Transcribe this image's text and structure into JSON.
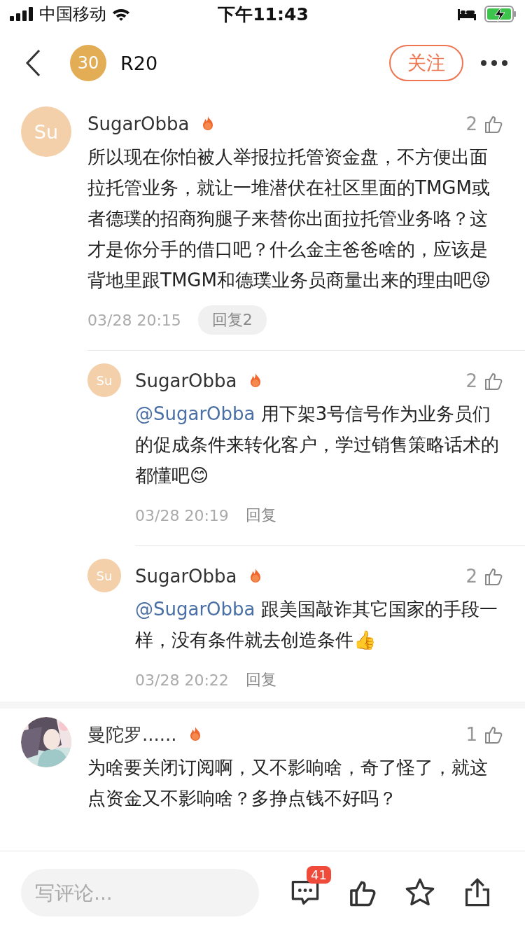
{
  "status_bar": {
    "carrier": "中国移动",
    "time": "下午11:43"
  },
  "header": {
    "level_badge": "30",
    "title": "R20",
    "follow_button": "关注"
  },
  "comments": [
    {
      "kind": "initials",
      "avatar_text": "Su",
      "author": "SugarObba",
      "likes": "2",
      "text": "所以现在你怕被人举报拉托管资金盘，不方便出面拉托管业务，就让一堆潜伏在社区里面的TMGM或者德璞的招商狗腿子来替你出面拉托管业务咯？这才是你分手的借口吧？什么金主爸爸啥的，应该是背地里跟TMGM和德璞业务员商量出来的理由吧😝",
      "time": "03/28 20:15",
      "reply_button": "回复2",
      "replies": [
        {
          "avatar_text": "Su",
          "author": "SugarObba",
          "likes": "2",
          "mention": "@SugarObba",
          "text": " 用下架3号信号作为业务员们的促成条件来转化客户，学过销售策略话术的都懂吧😊",
          "time": "03/28 20:19",
          "reply_button": "回复"
        },
        {
          "avatar_text": "Su",
          "author": "SugarObba",
          "likes": "2",
          "mention": "@SugarObba",
          "text": " 跟美国敲诈其它国家的手段一样，没有条件就去创造条件👍",
          "time": "03/28 20:22",
          "reply_button": "回复"
        }
      ]
    },
    {
      "kind": "picture",
      "author": "曼陀罗......",
      "likes": "1",
      "text": "为啥要关闭订阅啊，又不影响啥，奇了怪了，就这点资金又不影响啥？多挣点钱不好吗？"
    }
  ],
  "comment_bar": {
    "placeholder": "写评论...",
    "comment_count": "41"
  }
}
